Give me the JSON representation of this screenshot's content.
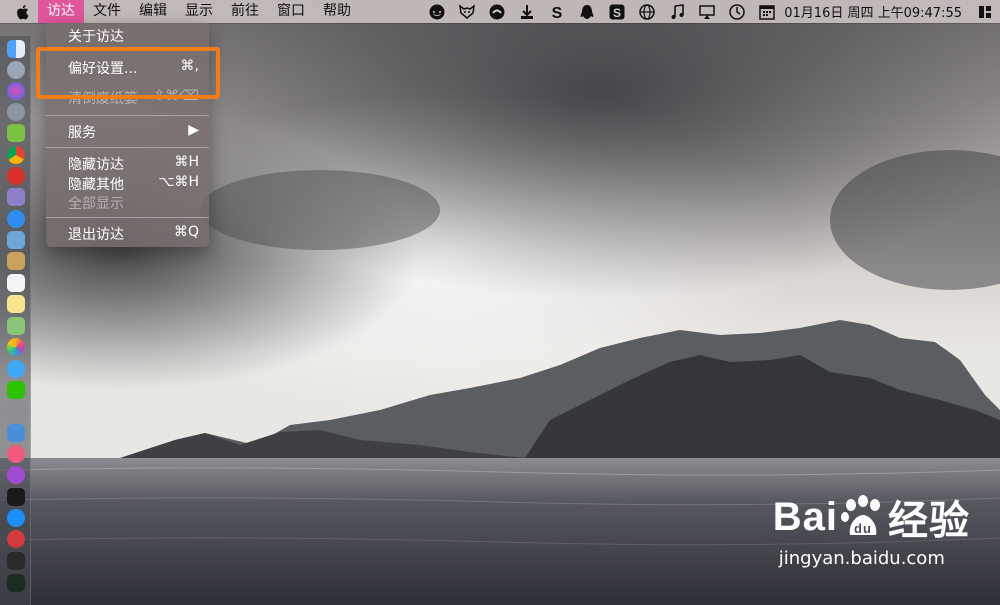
{
  "menubar": {
    "app_menu": "访达",
    "items": [
      "文件",
      "编辑",
      "显示",
      "前往",
      "窗口",
      "帮助"
    ],
    "clock": "01月16日 周四 上午09:47:55",
    "status_icons": [
      "chat-bubble-icon",
      "fox-icon",
      "baidu-netdisk-icon",
      "download-icon",
      "sogou-s-icon",
      "qq-penguin-icon",
      "sogou-input-icon",
      "globe-icon",
      "music-note-icon",
      "display-icon",
      "clock-icon",
      "calendar-icon",
      "grid-icon"
    ]
  },
  "finder_menu": {
    "about": "关于访达",
    "preferences": "偏好设置...",
    "preferences_shortcut": "⌘,",
    "empty_trash": "清倒废纸篓",
    "empty_trash_shortcut": "⇧⌘⌫",
    "services": "服务",
    "services_arrow": "▶",
    "hide": "隐藏访达",
    "hide_shortcut": "⌘H",
    "hide_others": "隐藏其他",
    "hide_others_shortcut": "⌥⌘H",
    "show_all": "全部显示",
    "quit": "退出访达",
    "quit_shortcut": "⌘Q"
  },
  "colors": {
    "menu_active": "#e0569c",
    "highlight": "#f07d1a"
  },
  "watermark": {
    "brand_left": "Bai",
    "brand_right": "经验",
    "url": "jingyan.baidu.com"
  },
  "dock_apps": [
    "finder",
    "launchpad",
    "siri",
    "rocket",
    "android",
    "chrome",
    "hanzi-app",
    "disk-utility",
    "safari",
    "preview",
    "notes-app",
    "calendar",
    "stickies",
    "maps",
    "photos",
    "messages",
    "wechat",
    "system-preferences",
    "keynote",
    "music",
    "podcasts",
    "apple-tv",
    "app-store",
    "vivaldi",
    "terminal",
    "activity-monitor"
  ]
}
